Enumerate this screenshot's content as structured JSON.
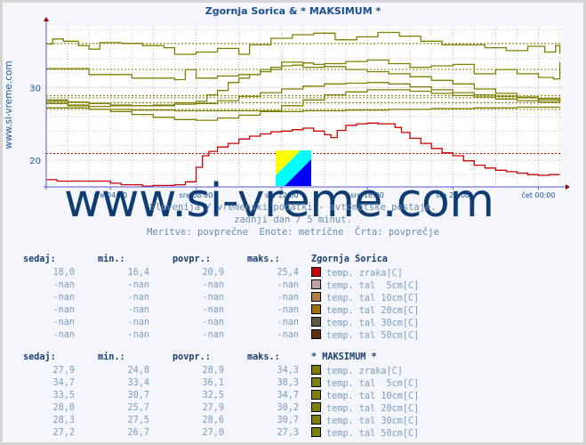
{
  "title": "Zgornja Sorica & * MAKSIMUM *",
  "side_label": "www.si-vreme.com",
  "watermark": "www.si-vreme.com",
  "subtitles": [
    "Slovenija / vremenski podatki - avtomatske postaje.",
    "zadnji dan / 5 minut.",
    "Meritve: povprečne  Enote: metrične  Črta: povprečje"
  ],
  "colors": {
    "axis": "#5555dd",
    "grid_red": "#e8a0a0",
    "grid_gray": "#c8c8c8",
    "red_series": "#cc0000",
    "olive_series": "#808000",
    "title": "#1a4f8c"
  },
  "chart_data": {
    "type": "line",
    "title": "Zgornja Sorica & * MAKSIMUM *",
    "xlabel": "",
    "ylabel": "",
    "x_hours_range": [
      1.0,
      25.1
    ],
    "ylim": [
      16.3,
      38.4
    ],
    "y_ticks": [
      20,
      30
    ],
    "x_ticks": [
      {
        "label": "sre 04:00",
        "hour": 4
      },
      {
        "label": "sre 08:00",
        "hour": 8
      },
      {
        "label": "sre 12:00",
        "hour": 12
      },
      {
        "label": "sre 16:00",
        "hour": 16
      },
      {
        "label": "sre 20:00",
        "hour": 20
      },
      {
        "label": "čet 00:00",
        "hour": 24
      }
    ],
    "grid": true,
    "series": [
      {
        "name": "Zgornja Sorica temp. zraka[C]",
        "color": "#cc0000",
        "avg": 20.9,
        "x": [
          1.0,
          1.5,
          2.0,
          3.0,
          4.0,
          4.5,
          5.5,
          6.0,
          7.0,
          7.5,
          8.0,
          8.3,
          8.6,
          9.0,
          9.5,
          10.0,
          10.5,
          11.0,
          11.5,
          12.0,
          12.5,
          13.0,
          13.5,
          14.0,
          14.3,
          14.6,
          15.0,
          15.5,
          16.0,
          16.5,
          17.0,
          17.3,
          17.6,
          18.0,
          18.5,
          19.0,
          19.5,
          20.0,
          20.5,
          21.0,
          21.5,
          22.0,
          22.5,
          23.0,
          23.5,
          24.0,
          24.5,
          25.0
        ],
        "y": [
          17.3,
          17.1,
          17.1,
          17.1,
          16.8,
          16.6,
          16.4,
          16.5,
          16.6,
          17.0,
          19.0,
          20.6,
          21.2,
          21.8,
          22.3,
          22.9,
          23.3,
          23.6,
          23.9,
          24.0,
          24.2,
          24.4,
          24.0,
          23.5,
          23.1,
          24.1,
          24.8,
          25.0,
          25.1,
          25.0,
          25.0,
          24.5,
          23.8,
          23.0,
          22.3,
          21.6,
          21.0,
          20.6,
          19.9,
          19.3,
          18.9,
          18.6,
          18.4,
          18.2,
          18.0,
          17.9,
          18.0,
          18.0
        ]
      },
      {
        "name": "MAKSIMUM temp. tal 5cm[C]",
        "color": "#808000",
        "avg": 36.1,
        "x": [
          1.0,
          1.3,
          1.8,
          2.5,
          3.0,
          3.5,
          4.5,
          5.5,
          6.5,
          7.0,
          8.0,
          9.0,
          10.0,
          10.5,
          11.5,
          12.5,
          13.5,
          14.5,
          15.5,
          16.5,
          17.5,
          18.5,
          19.5,
          20.5,
          21.5,
          22.5,
          23.5,
          24.3,
          24.8,
          25.0
        ],
        "y": [
          36.0,
          36.7,
          36.4,
          35.8,
          35.3,
          36.2,
          36.1,
          35.8,
          35.5,
          34.6,
          34.9,
          35.4,
          34.6,
          35.9,
          36.8,
          37.3,
          37.5,
          36.6,
          37.0,
          37.6,
          37.1,
          36.4,
          35.9,
          35.9,
          35.5,
          35.1,
          35.7,
          34.9,
          35.8,
          34.7
        ]
      },
      {
        "name": "MAKSIMUM temp. tal 10cm[C]",
        "color": "#808000",
        "avg": 32.5,
        "x": [
          1.0,
          2.0,
          3.0,
          4.0,
          5.0,
          6.0,
          7.0,
          7.5,
          8.0,
          9.0,
          10.0,
          11.0,
          12.0,
          13.0,
          14.0,
          15.0,
          16.0,
          17.0,
          18.0,
          19.0,
          20.0,
          21.0,
          22.0,
          23.0,
          24.0,
          24.7,
          25.0
        ],
        "y": [
          32.6,
          32.6,
          31.8,
          31.8,
          31.3,
          31.3,
          31.1,
          32.5,
          31.3,
          31.6,
          31.8,
          32.5,
          33.5,
          32.8,
          33.3,
          33.6,
          33.8,
          33.3,
          32.8,
          33.0,
          33.2,
          31.9,
          32.5,
          31.9,
          31.4,
          31.2,
          33.5
        ]
      },
      {
        "name": "MAKSIMUM temp. tal 20cm[C]",
        "color": "#808000",
        "avg": 27.9,
        "x": [
          1.0,
          2.0,
          3.0,
          4.0,
          5.0,
          6.0,
          7.0,
          8.0,
          9.0,
          10.0,
          11.0,
          12.0,
          13.0,
          14.0,
          15.0,
          16.0,
          17.0,
          18.0,
          19.0,
          20.0,
          21.0,
          22.0,
          23.0,
          24.0,
          25.0
        ],
        "y": [
          28.1,
          27.5,
          27.0,
          26.7,
          26.3,
          25.9,
          25.6,
          25.5,
          25.8,
          26.2,
          26.8,
          27.5,
          28.3,
          29.0,
          29.4,
          29.7,
          29.7,
          29.5,
          29.2,
          28.9,
          28.7,
          28.4,
          28.2,
          28.0,
          28.0
        ]
      },
      {
        "name": "MAKSIMUM temp. tal 30cm[C]",
        "color": "#808000",
        "avg": 28.6,
        "x": [
          1.0,
          2.0,
          3.0,
          4.0,
          5.0,
          6.0,
          7.0,
          8.0,
          9.0,
          10.0,
          11.0,
          12.0,
          13.0,
          14.0,
          15.0,
          16.0,
          17.0,
          18.0,
          19.0,
          20.0,
          21.0,
          22.0,
          23.0,
          24.0,
          25.0
        ],
        "y": [
          28.3,
          28.0,
          27.8,
          27.6,
          27.5,
          27.5,
          27.7,
          27.8,
          28.2,
          28.8,
          29.3,
          29.8,
          30.2,
          30.5,
          30.6,
          30.7,
          30.5,
          30.1,
          29.7,
          29.3,
          29.0,
          28.8,
          28.6,
          28.5,
          28.3
        ]
      },
      {
        "name": "MAKSIMUM temp. tal 50cm[C]",
        "color": "#808000",
        "avg": 27.0,
        "x": [
          1.0,
          3.0,
          5.0,
          7.0,
          9.0,
          11.0,
          13.0,
          15.0,
          17.0,
          19.0,
          21.0,
          23.0,
          25.0
        ],
        "y": [
          27.2,
          27.0,
          26.9,
          26.8,
          26.8,
          26.7,
          26.8,
          26.9,
          27.0,
          27.1,
          27.2,
          27.3,
          27.2
        ]
      },
      {
        "name": "MAKSIMUM temp. zraka[C]",
        "color": "#808000",
        "avg": 28.9,
        "x": [
          1.0,
          2.0,
          3.0,
          4.0,
          5.0,
          6.0,
          7.0,
          8.0,
          8.5,
          9.0,
          9.5,
          10.0,
          10.5,
          11.0,
          11.5,
          12.0,
          12.5,
          13.0,
          13.5,
          14.0,
          15.0,
          16.0,
          17.0,
          18.0,
          19.0,
          20.0,
          21.0,
          22.0,
          23.0,
          24.0,
          25.0
        ],
        "y": [
          27.8,
          27.6,
          27.4,
          27.5,
          27.5,
          27.6,
          27.9,
          28.1,
          29.0,
          29.6,
          30.7,
          31.3,
          31.8,
          32.2,
          32.8,
          33.0,
          33.1,
          33.4,
          33.2,
          32.9,
          32.5,
          32.2,
          31.9,
          31.5,
          31.0,
          30.5,
          29.8,
          29.2,
          28.7,
          28.3,
          27.9
        ]
      }
    ],
    "tables": [
      {
        "station": "Zgornja Sorica",
        "headers": [
          "sedaj:",
          "min.:",
          "povpr.:",
          "maks.:"
        ],
        "rows": [
          {
            "now": "18,0",
            "min": "16,4",
            "avg": "20,9",
            "max": "25,4",
            "label": "temp. zraka[C]",
            "color": "#cc0000"
          },
          {
            "now": "-nan",
            "min": "-nan",
            "avg": "-nan",
            "max": "-nan",
            "label": "temp. tal  5cm[C]",
            "color": "#c0a0a0"
          },
          {
            "now": "-nan",
            "min": "-nan",
            "avg": "-nan",
            "max": "-nan",
            "label": "temp. tal 10cm[C]",
            "color": "#b08040"
          },
          {
            "now": "-nan",
            "min": "-nan",
            "avg": "-nan",
            "max": "-nan",
            "label": "temp. tal 20cm[C]",
            "color": "#a07000"
          },
          {
            "now": "-nan",
            "min": "-nan",
            "avg": "-nan",
            "max": "-nan",
            "label": "temp. tal 30cm[C]",
            "color": "#605840"
          },
          {
            "now": "-nan",
            "min": "-nan",
            "avg": "-nan",
            "max": "-nan",
            "label": "temp. tal 50cm[C]",
            "color": "#603010"
          }
        ]
      },
      {
        "station": "* MAKSIMUM *",
        "headers": [
          "sedaj:",
          "min.:",
          "povpr.:",
          "maks.:"
        ],
        "rows": [
          {
            "now": "27,9",
            "min": "24,8",
            "avg": "28,9",
            "max": "34,3",
            "label": "temp. zraka[C]",
            "color": "#808000"
          },
          {
            "now": "34,7",
            "min": "33,4",
            "avg": "36,1",
            "max": "38,3",
            "label": "temp. tal  5cm[C]",
            "color": "#808000"
          },
          {
            "now": "33,5",
            "min": "30,7",
            "avg": "32,5",
            "max": "34,7",
            "label": "temp. tal 10cm[C]",
            "color": "#808000"
          },
          {
            "now": "28,0",
            "min": "25,7",
            "avg": "27,9",
            "max": "30,2",
            "label": "temp. tal 20cm[C]",
            "color": "#808000"
          },
          {
            "now": "28,3",
            "min": "27,5",
            "avg": "28,6",
            "max": "30,7",
            "label": "temp. tal 30cm[C]",
            "color": "#808000"
          },
          {
            "now": "27,2",
            "min": "26,7",
            "avg": "27,0",
            "max": "27,3",
            "label": "temp. tal 50cm[C]",
            "color": "#808000"
          }
        ]
      }
    ]
  }
}
